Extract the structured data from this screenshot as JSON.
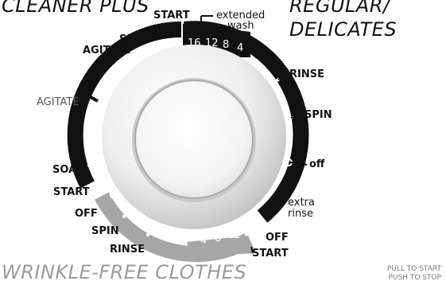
{
  "cycles": {
    "cleaner_plus": "CLEANER PLUS",
    "regular_line1": "REGULAR/",
    "regular_line2": "DELICATES",
    "wrinkle_free": "WRINKLE-FREE CLOTHES"
  },
  "extended_wash": {
    "start": "START",
    "label_line1": "extended",
    "label_line2": "wash",
    "minutes": [
      "16",
      "12",
      "8",
      "4"
    ]
  },
  "cleaner_plus_steps": {
    "spin": "SPIN",
    "agitate_top": "AGITATE",
    "agitate": "AGITATE",
    "soak": "SOAK",
    "start": "START"
  },
  "regular_steps": {
    "rinse": "RINSE",
    "spin": "SPIN",
    "off": "off",
    "extra_rinse_line1": "extra",
    "extra_rinse_line2": "rinse",
    "off_caps": "OFF",
    "start": "START"
  },
  "wrinkle_free_steps": {
    "off": "OFF",
    "spin": "SPIN",
    "rinse": "RINSE",
    "minutes": [
      "4",
      "8",
      "12"
    ]
  },
  "instructions": {
    "line1": "PULL TO START",
    "line2": "PUSH TO STOP"
  },
  "colors": {
    "black_ring": "#111111",
    "gray_ring": "#a6a6a6",
    "knob_light": "#f2f2f2",
    "knob_dark": "#c4c4c4"
  }
}
